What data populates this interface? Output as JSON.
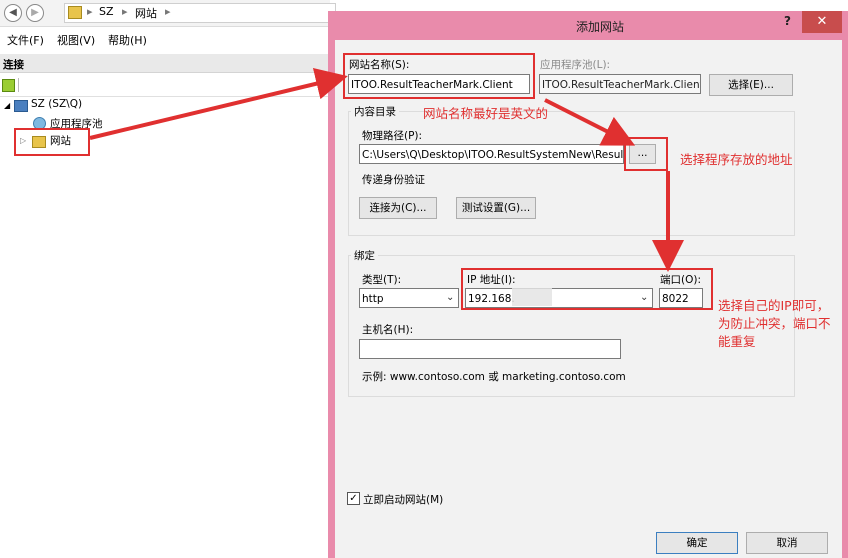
{
  "explorer": {
    "breadcrumb": [
      "SZ",
      "网站"
    ],
    "menu": [
      "文件(F)",
      "视图(V)",
      "帮助(H)"
    ],
    "connections_title": "连接",
    "tree": {
      "root": "SZ (SZ\\Q)",
      "app_pools": "应用程序池",
      "sites": "网站"
    }
  },
  "dialog": {
    "title": "添加网站",
    "help": "?",
    "close": "✕",
    "site_name_label": "网站名称(S):",
    "site_name_value": "ITOO.ResultTeacherMark.Client",
    "app_pool_label": "应用程序池(L):",
    "app_pool_value": "ITOO.ResultTeacherMark.Client",
    "select_button": "选择(E)...",
    "content_dir_label": "内容目录",
    "physical_path_label": "物理路径(P):",
    "physical_path_value": "C:\\Users\\Q\\Desktop\\ITOO.ResultSystemNew\\Result",
    "browse_button": "...",
    "passthrough_label": "传递身份验证",
    "connect_as_button": "连接为(C)...",
    "test_settings_button": "测试设置(G)...",
    "binding_label": "绑定",
    "type_label": "类型(T):",
    "type_value": "http",
    "ip_label": "IP 地址(I):",
    "ip_value": "192.168.",
    "port_label": "端口(O):",
    "port_value": "8022",
    "hostname_label": "主机名(H):",
    "hostname_value": "",
    "example_text": "示例: www.contoso.com 或 marketing.contoso.com",
    "start_checkbox_label": "立即启动网站(M)",
    "start_checked": true,
    "ok_button": "确定",
    "cancel_button": "取消"
  },
  "annotations": {
    "site_name_note": "网站名称最好是英文的",
    "path_note": "选择程序存放的地址",
    "ip_note_line1": "选择自己的IP即可，",
    "ip_note_line2": "为防止冲突，端口不",
    "ip_note_line3": "能重复",
    "color": "#e03030"
  },
  "colors": {
    "dialog_frame": "#e98bab",
    "close_button": "#c84d4d"
  }
}
